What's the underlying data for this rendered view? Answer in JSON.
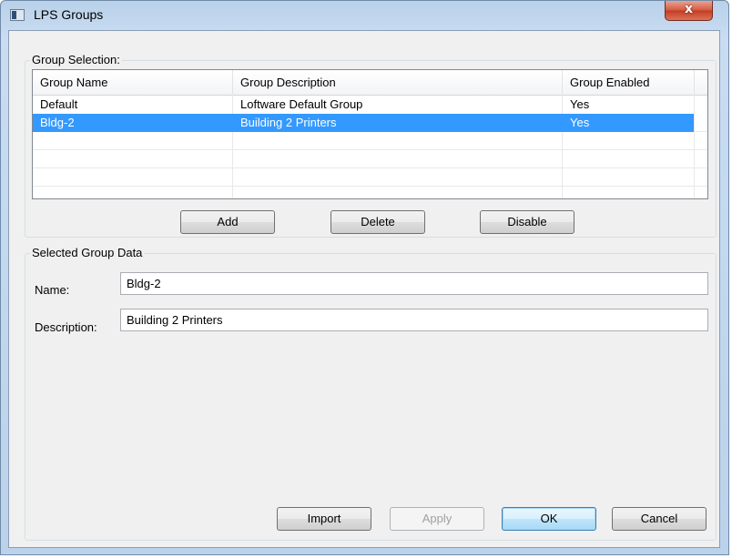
{
  "window": {
    "title": "LPS Groups",
    "close_glyph": "x"
  },
  "group_selection": {
    "legend": "Group Selection:",
    "columns": [
      "Group Name",
      "Group Description",
      "Group Enabled"
    ],
    "rows": [
      {
        "name": "Default",
        "description": "Loftware Default Group",
        "enabled": "Yes",
        "selected": false
      },
      {
        "name": "Bldg-2",
        "description": "Building 2 Printers",
        "enabled": "Yes",
        "selected": true
      }
    ],
    "buttons": {
      "add": "Add",
      "delete": "Delete",
      "disable": "Disable"
    }
  },
  "selected_group": {
    "legend": "Selected Group Data",
    "name_label": "Name:",
    "name_value": "Bldg-2",
    "description_label": "Description:",
    "description_value": "Building 2 Printers"
  },
  "footer": {
    "import": "Import",
    "apply": "Apply",
    "ok": "OK",
    "cancel": "Cancel"
  },
  "colors": {
    "selection": "#3399ff"
  }
}
